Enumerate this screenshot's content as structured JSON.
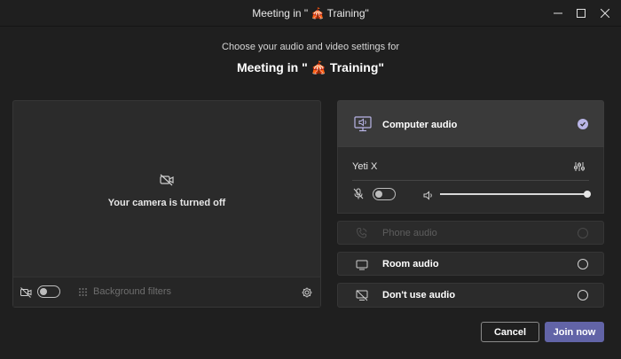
{
  "window": {
    "title": "Meeting in \" 🎪 Training\""
  },
  "header": {
    "subtitle": "Choose your audio and video settings for",
    "meeting_title": "Meeting in \" 🎪 Training\""
  },
  "camera": {
    "status_text": "Your camera is turned off",
    "camera_toggle_on": false,
    "background_filters_label": "Background filters"
  },
  "audio": {
    "options": [
      {
        "label": "Computer audio",
        "selected": true,
        "enabled": true,
        "icon": "computer-audio-icon"
      },
      {
        "label": "Phone audio",
        "selected": false,
        "enabled": false,
        "icon": "phone-audio-icon"
      },
      {
        "label": "Room audio",
        "selected": false,
        "enabled": true,
        "icon": "room-audio-icon"
      },
      {
        "label": "Don't use audio",
        "selected": false,
        "enabled": true,
        "icon": "no-audio-icon"
      }
    ],
    "device_name": "Yeti X",
    "mic_toggle_on": false,
    "volume_level": 1.0
  },
  "buttons": {
    "cancel": "Cancel",
    "join": "Join now"
  },
  "colors": {
    "accent": "#6264a7",
    "selected_check": "#b9b5e6",
    "background": "#1f1f1f"
  }
}
